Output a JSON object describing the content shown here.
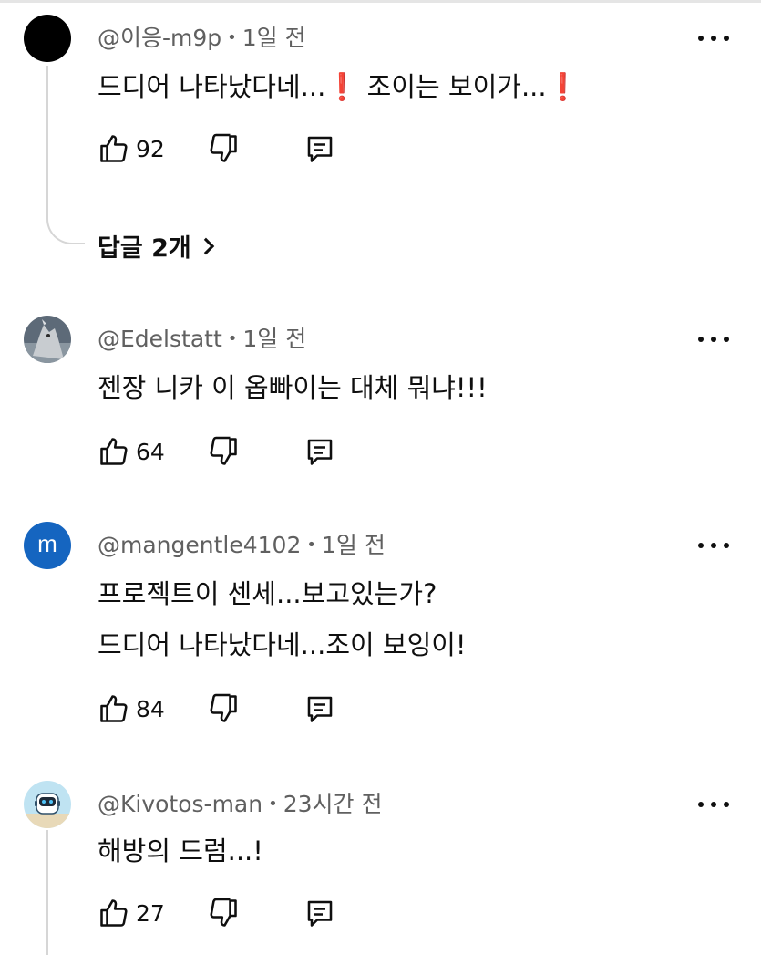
{
  "comments": [
    {
      "author": "@이응-m9p",
      "time": "1일 전",
      "text_parts": [
        "드디어 나타났다네...",
        "❗",
        " 조이는 보이가...",
        "❗"
      ],
      "likes": "92",
      "replies_label": "답글 2개"
    },
    {
      "author": "@Edelstatt",
      "time": "1일 전",
      "lines": [
        "젠장 니카 이 옵빠이는 대체 뭐냐!!!"
      ],
      "likes": "64"
    },
    {
      "author": "@mangentle4102",
      "time": "1일 전",
      "avatar_letter": "m",
      "lines": [
        "프로젝트이 센세...보고있는가?",
        "드디어 나타났다네...조이 보잉이!"
      ],
      "likes": "84"
    },
    {
      "author": "@Kivotos-man",
      "time": "23시간 전",
      "lines": [
        "해방의 드럼...!"
      ],
      "likes": "27"
    }
  ],
  "icons": [
    "thumbs-up-icon",
    "thumbs-down-icon",
    "reply-icon",
    "more-vert-icon",
    "chevron-right-icon"
  ],
  "colors": {
    "accent_avatar_blue": "#1565c0",
    "meta_gray": "#606060",
    "exclamation_red": "#e0242a",
    "thread_line": "#d6d6d6"
  }
}
